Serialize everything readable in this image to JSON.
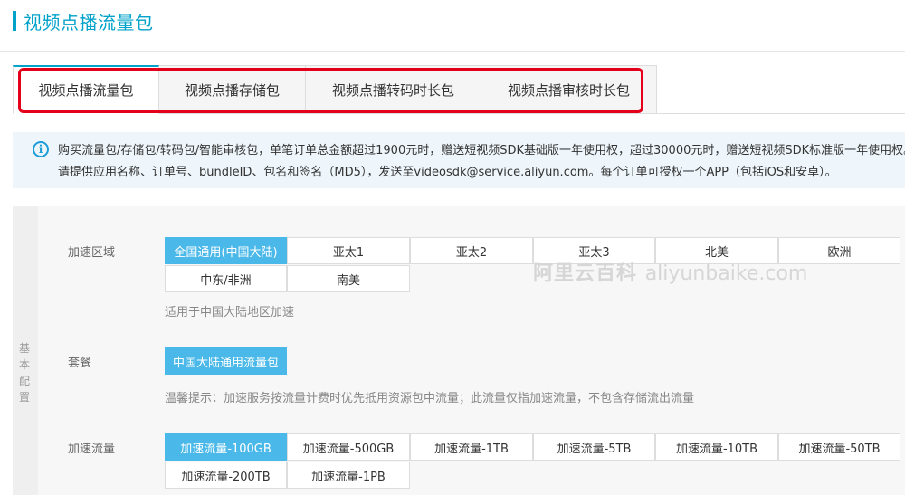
{
  "page_title": "视频点播流量包",
  "tabs": [
    {
      "label": "视频点播流量包"
    },
    {
      "label": "视频点播存储包"
    },
    {
      "label": "视频点播转码时长包"
    },
    {
      "label": "视频点播审核时长包"
    }
  ],
  "active_tab": 0,
  "notice": {
    "line1": "购买流量包/存储包/转码包/智能审核包，单笔订单总金额超过1900元时，赠送短视频SDK基础版一年使用权，超过30000元时，赠送短视频SDK标准版一年使用权。",
    "line2": "请提供应用名称、订单号、bundleID、包名和签名（MD5），发送至videosdk@service.aliyun.com。每个订单可授权一个APP（包括iOS和安卓）。",
    "icon": "info-icon"
  },
  "config": {
    "side_label": "基本配置",
    "region": {
      "label": "加速区域",
      "options": [
        "全国通用(中国大陆)",
        "亚太1",
        "亚太2",
        "亚太3",
        "北美",
        "欧洲",
        "中东/非洲",
        "南美"
      ],
      "selected": 0,
      "hint": "适用于中国大陆地区加速"
    },
    "package": {
      "label": "套餐",
      "options": [
        "中国大陆通用流量包"
      ],
      "selected": 0,
      "hint": "温馨提示：加速服务按流量计费时优先抵用资源包中流量；此流量仅指加速流量，不包含存储流出流量"
    },
    "traffic": {
      "label": "加速流量",
      "options": [
        "加速流量-100GB",
        "加速流量-500GB",
        "加速流量-1TB",
        "加速流量-5TB",
        "加速流量-10TB",
        "加速流量-50TB",
        "加速流量-200TB",
        "加速流量-1PB"
      ],
      "selected": 0
    }
  },
  "watermark": {
    "cn": "阿里云百科",
    "en": "aliyunbaike.com"
  },
  "colors": {
    "accent": "#00a2ca",
    "selected": "#4ab8e8",
    "highlight": "#e4001b"
  }
}
